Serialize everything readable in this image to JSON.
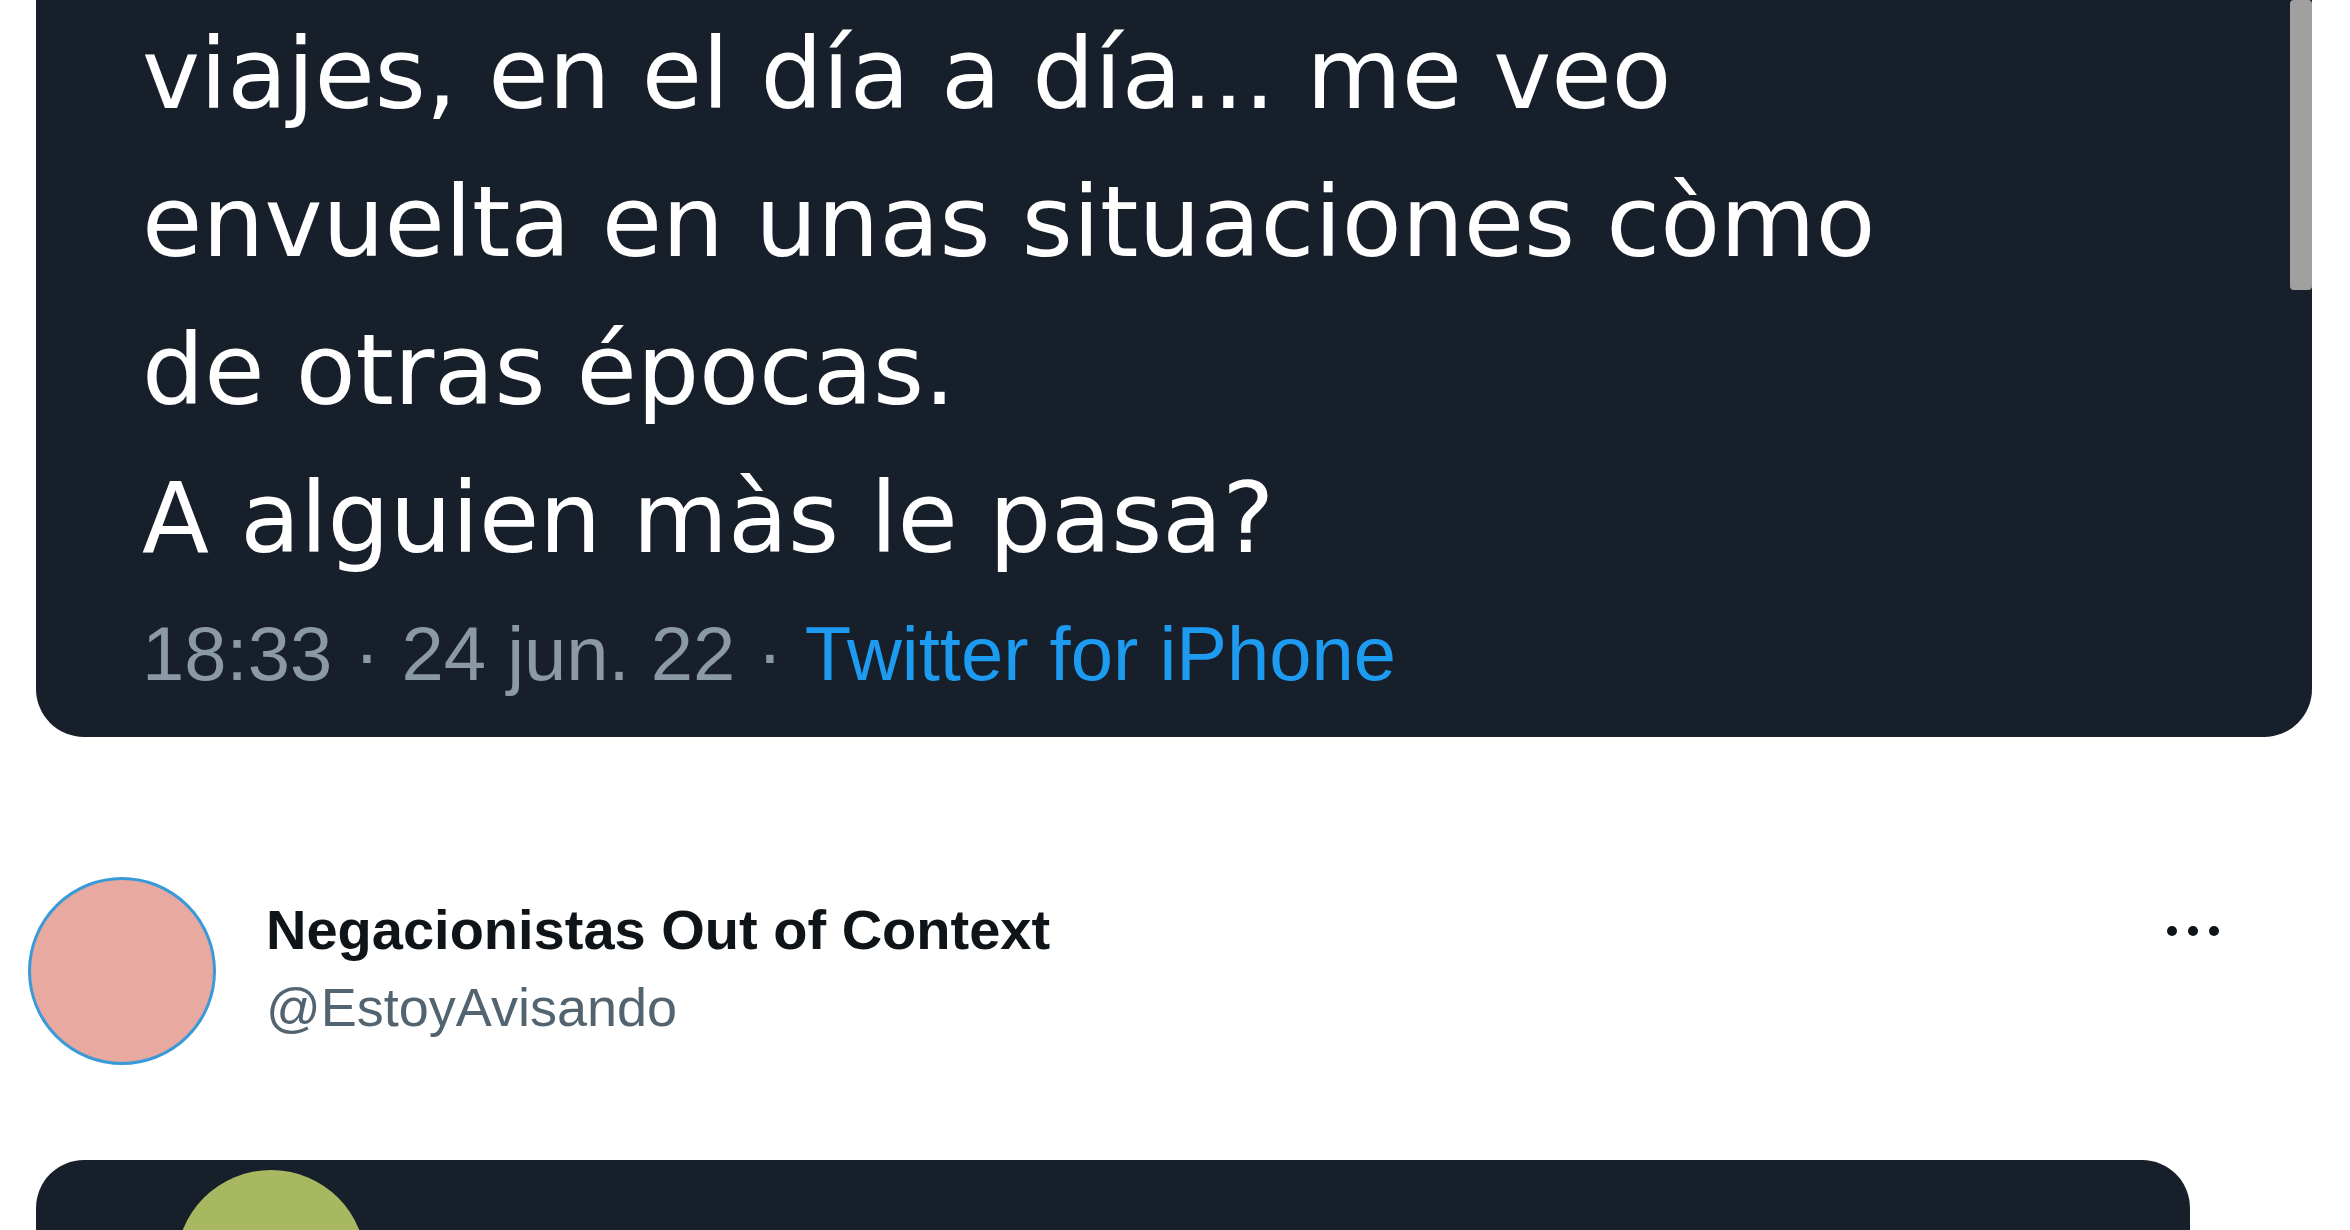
{
  "quoted_tweet": {
    "lines": [
      "viajes, en el día a día... me veo",
      "envuelta en unas situaciones còmo",
      "de otras épocas.",
      "A alguien màs le pasa?"
    ],
    "time": "18:33",
    "date": "24 jun. 22",
    "source": "Twitter for iPhone",
    "separator": "·"
  },
  "tweet": {
    "name": "Negacionistas Out of Context",
    "handle": "@EstoyAvisando"
  }
}
